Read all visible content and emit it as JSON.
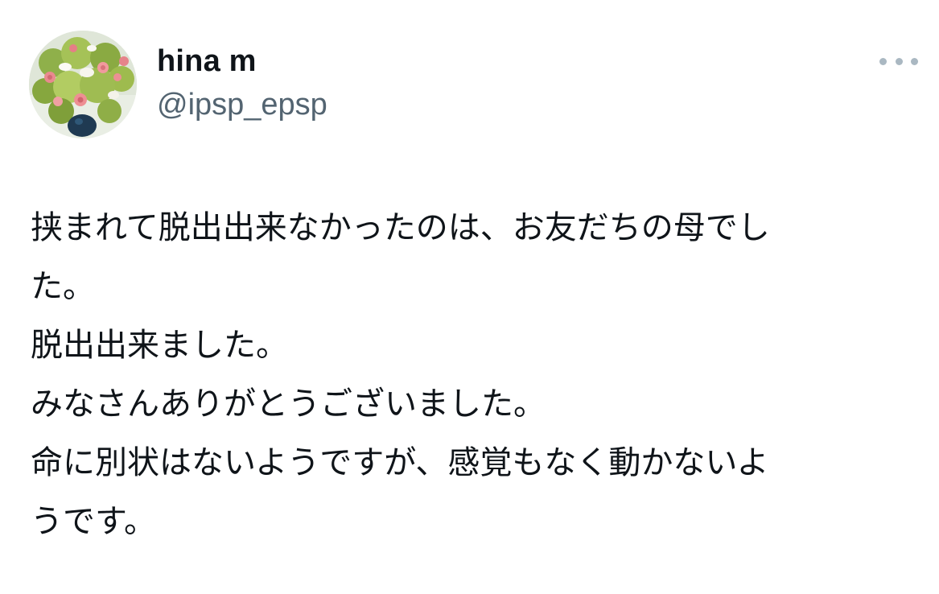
{
  "user": {
    "display_name": "hina m",
    "handle": "@ipsp_epsp",
    "avatar_icon": "flower-bouquet-avatar"
  },
  "menu": {
    "icon": "more-dots-icon"
  },
  "tweet": {
    "lines": [
      "挟まれて脱出出来なかったのは、お友だちの母でし",
      "た。",
      "脱出出来ました。",
      "みなさんありがとうございました。",
      "命に別状はないようですが、感覚もなく動かないよ",
      "うです。"
    ]
  },
  "colors": {
    "text_primary": "#0f1419",
    "text_secondary": "#536471",
    "menu_dots": "#aab8c2",
    "background": "#ffffff"
  }
}
